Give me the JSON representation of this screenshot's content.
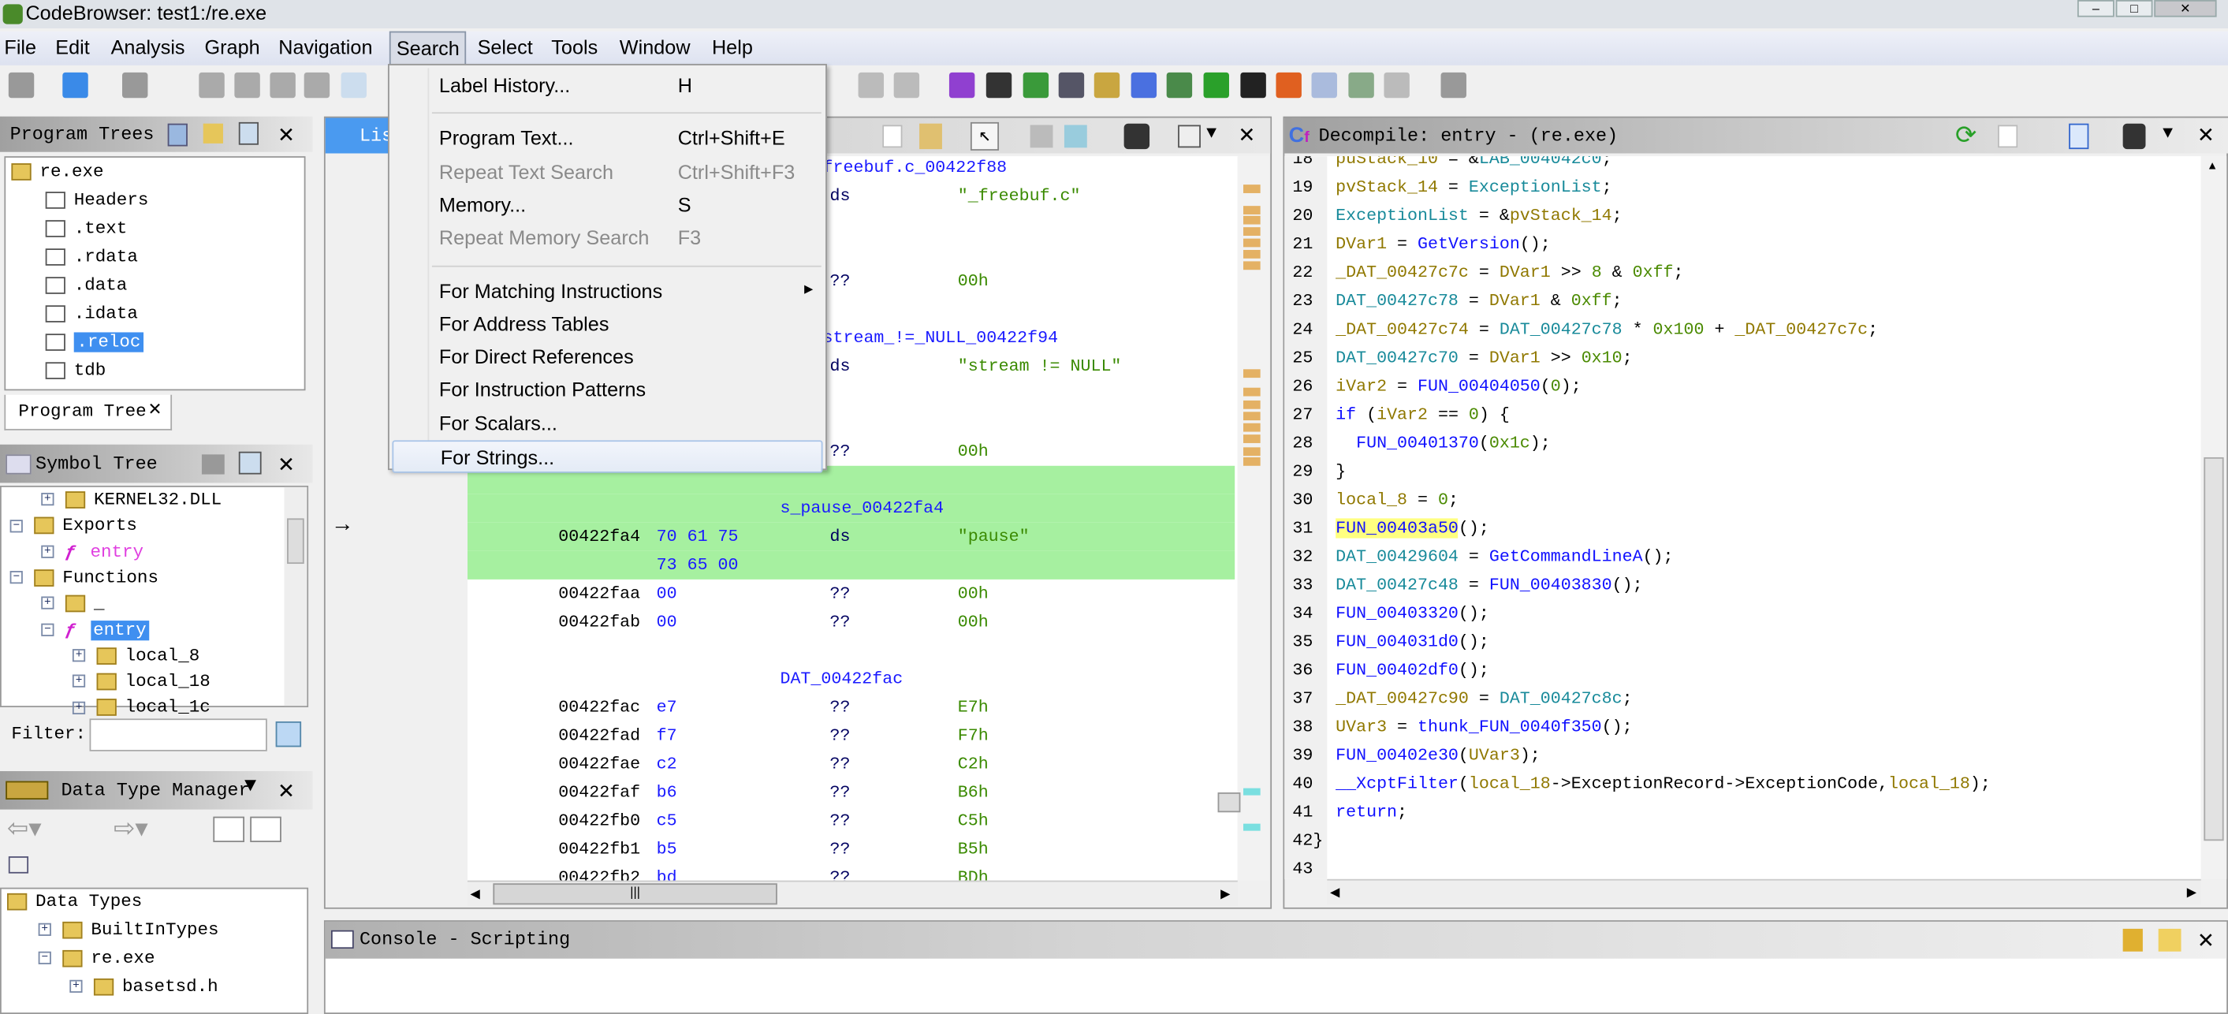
{
  "window": {
    "title": "CodeBrowser: test1:/re.exe",
    "controls": [
      "–",
      "□",
      "✕"
    ]
  },
  "menubar": [
    "File",
    "Edit",
    "Analysis",
    "Graph",
    "Navigation",
    "Search",
    "Select",
    "Tools",
    "Window",
    "Help"
  ],
  "search_menu": [
    {
      "label": "Label History...",
      "shortcut": "H"
    },
    {
      "sep": true
    },
    {
      "label": "Program Text...",
      "shortcut": "Ctrl+Shift+E"
    },
    {
      "label": "Repeat Text Search",
      "shortcut": "Ctrl+Shift+F3",
      "disabled": true
    },
    {
      "label": "Memory...",
      "shortcut": "S"
    },
    {
      "label": "Repeat Memory Search",
      "shortcut": "F3",
      "disabled": true
    },
    {
      "sep": true
    },
    {
      "label": "For Matching Instructions",
      "submenu": true
    },
    {
      "label": "For Address Tables"
    },
    {
      "label": "For Direct References"
    },
    {
      "label": "For Instruction Patterns"
    },
    {
      "label": "For Scalars..."
    },
    {
      "label": "For Strings...",
      "hover": true
    }
  ],
  "program_trees": {
    "title": "Program Trees",
    "tab": "Program Tree",
    "items": [
      {
        "label": "re.exe",
        "level": 0
      },
      {
        "label": "Headers",
        "level": 1
      },
      {
        "label": ".text",
        "level": 1
      },
      {
        "label": ".rdata",
        "level": 1
      },
      {
        "label": ".data",
        "level": 1
      },
      {
        "label": ".idata",
        "level": 1
      },
      {
        "label": ".reloc",
        "level": 1,
        "selected": true
      },
      {
        "label": "tdb",
        "level": 1
      }
    ]
  },
  "symbol_tree": {
    "title": "Symbol Tree",
    "filter_label": "Filter:",
    "filter_value": "",
    "items": [
      {
        "label": "KERNEL32.DLL",
        "level": 1,
        "pm": "+"
      },
      {
        "label": "Exports",
        "level": 0,
        "pm": "-"
      },
      {
        "label": "entry",
        "level": 1,
        "pm": "+",
        "fn": true,
        "color": "#e040e0"
      },
      {
        "label": "Functions",
        "level": 0,
        "pm": "-"
      },
      {
        "label": "_",
        "level": 1,
        "pm": "+"
      },
      {
        "label": "entry",
        "level": 1,
        "pm": "-",
        "fn": true,
        "selected": true
      },
      {
        "label": "local_8",
        "level": 2,
        "pm": "+"
      },
      {
        "label": "local_18",
        "level": 2,
        "pm": "+"
      },
      {
        "label": "local_1c",
        "level": 2,
        "pm": "+"
      }
    ]
  },
  "data_type_manager": {
    "title": "Data Type Manager",
    "items": [
      {
        "label": "Data Types",
        "level": 0
      },
      {
        "label": "BuiltInTypes",
        "level": 1,
        "pm": "+"
      },
      {
        "label": "re.exe",
        "level": 1,
        "pm": "-"
      },
      {
        "label": "basetsd.h",
        "level": 2,
        "pm": "+"
      }
    ]
  },
  "listing": {
    "title": "Listing",
    "rows": [
      {
        "label": "freebuf.c_00422f88",
        "partial": true
      },
      {
        "mn": "ds",
        "op": "\"_freebuf.c\""
      },
      {},
      {},
      {
        "mn": "??",
        "op": "00h"
      },
      {},
      {
        "label": "stream_!=_NULL_00422f94",
        "partial": true
      },
      {
        "mn": "ds",
        "op": "\"stream != NULL\""
      },
      {},
      {},
      {
        "mn": "??",
        "op": "00h"
      },
      {
        "hl": true
      },
      {
        "hl": true,
        "label": "s_pause_00422fa4"
      },
      {
        "hl": true,
        "addr": "00422fa4",
        "bytes": "70 61 75",
        "mn": "ds",
        "op": "\"pause\""
      },
      {
        "hl": true,
        "bytes": "73 65 00"
      },
      {
        "addr": "00422faa",
        "bytes": "00",
        "mn": "??",
        "op": "00h"
      },
      {
        "addr": "00422fab",
        "bytes": "00",
        "mn": "??",
        "op": "00h"
      },
      {},
      {
        "label": "DAT_00422fac"
      },
      {
        "addr": "00422fac",
        "bytes": "e7",
        "mn": "??",
        "op": "E7h"
      },
      {
        "addr": "00422fad",
        "bytes": "f7",
        "mn": "??",
        "op": "F7h"
      },
      {
        "addr": "00422fae",
        "bytes": "c2",
        "mn": "??",
        "op": "C2h"
      },
      {
        "addr": "00422faf",
        "bytes": "b6",
        "mn": "??",
        "op": "B6h"
      },
      {
        "addr": "00422fb0",
        "bytes": "c5",
        "mn": "??",
        "op": "C5h"
      },
      {
        "addr": "00422fb1",
        "bytes": "b5",
        "mn": "??",
        "op": "B5h"
      },
      {
        "addr": "00422fb2",
        "bytes": "bd",
        "mn": "??",
        "op": "BDh"
      }
    ]
  },
  "decompile": {
    "title": "Decompile: entry -  (re.exe)",
    "lines": [
      {
        "n": "18",
        "t": [
          [
            "puStack_10",
            "v"
          ],
          [
            " = &",
            ""
          ],
          [
            "LAB_004042c0",
            "g"
          ],
          [
            ";",
            ""
          ]
        ]
      },
      {
        "n": "19",
        "t": [
          [
            "pvStack_14",
            "v"
          ],
          [
            " = ",
            ""
          ],
          [
            "ExceptionList",
            "g"
          ],
          [
            ";",
            ""
          ]
        ]
      },
      {
        "n": "20",
        "t": [
          [
            "ExceptionList",
            "g"
          ],
          [
            " = &",
            ""
          ],
          [
            "pvStack_14",
            "v"
          ],
          [
            ";",
            ""
          ]
        ]
      },
      {
        "n": "21",
        "t": [
          [
            "DVar1",
            "v"
          ],
          [
            " = ",
            ""
          ],
          [
            "GetVersion",
            "f"
          ],
          [
            "();",
            ""
          ]
        ]
      },
      {
        "n": "22",
        "t": [
          [
            "_DAT_00427c7c",
            "v"
          ],
          [
            " = ",
            ""
          ],
          [
            "DVar1",
            "v"
          ],
          [
            " >> ",
            ""
          ],
          [
            "8",
            "c"
          ],
          [
            " & ",
            ""
          ],
          [
            "0xff",
            "c"
          ],
          [
            ";",
            ""
          ]
        ]
      },
      {
        "n": "23",
        "t": [
          [
            "DAT_00427c78",
            "g"
          ],
          [
            " = ",
            ""
          ],
          [
            "DVar1",
            "v"
          ],
          [
            " & ",
            ""
          ],
          [
            "0xff",
            "c"
          ],
          [
            ";",
            ""
          ]
        ]
      },
      {
        "n": "24",
        "t": [
          [
            "_DAT_00427c74",
            "v"
          ],
          [
            " = ",
            ""
          ],
          [
            "DAT_00427c78",
            "g"
          ],
          [
            " * ",
            ""
          ],
          [
            "0x100",
            "c"
          ],
          [
            " + ",
            ""
          ],
          [
            "_DAT_00427c7c",
            "v"
          ],
          [
            ";",
            ""
          ]
        ]
      },
      {
        "n": "25",
        "t": [
          [
            "DAT_00427c70",
            "g"
          ],
          [
            " = ",
            ""
          ],
          [
            "DVar1",
            "v"
          ],
          [
            " >> ",
            ""
          ],
          [
            "0x10",
            "c"
          ],
          [
            ";",
            ""
          ]
        ]
      },
      {
        "n": "26",
        "t": [
          [
            "iVar2",
            "v"
          ],
          [
            " = ",
            ""
          ],
          [
            "FUN_00404050",
            "f"
          ],
          [
            "(",
            ""
          ],
          [
            "0",
            "c"
          ],
          [
            ");",
            ""
          ]
        ]
      },
      {
        "n": "27",
        "t": [
          [
            "if",
            "k"
          ],
          [
            " (",
            ""
          ],
          [
            "iVar2",
            "v"
          ],
          [
            " == ",
            ""
          ],
          [
            "0",
            "c"
          ],
          [
            ") {",
            ""
          ]
        ]
      },
      {
        "n": "28",
        "t": [
          [
            "  ",
            ""
          ],
          [
            "FUN_00401370",
            "f"
          ],
          [
            "(",
            ""
          ],
          [
            "0x1c",
            "c"
          ],
          [
            ");",
            ""
          ]
        ]
      },
      {
        "n": "29",
        "t": [
          [
            "}",
            ""
          ]
        ]
      },
      {
        "n": "30",
        "t": [
          [
            "local_8",
            "v"
          ],
          [
            " = ",
            ""
          ],
          [
            "0",
            "c"
          ],
          [
            ";",
            ""
          ]
        ]
      },
      {
        "n": "31",
        "t": [
          [
            "FUN_00403a50",
            "fh"
          ],
          [
            "();",
            ""
          ]
        ]
      },
      {
        "n": "32",
        "t": [
          [
            "DAT_00429604",
            "g"
          ],
          [
            " = ",
            ""
          ],
          [
            "GetCommandLineA",
            "f"
          ],
          [
            "();",
            ""
          ]
        ]
      },
      {
        "n": "33",
        "t": [
          [
            "DAT_00427c48",
            "g"
          ],
          [
            " = ",
            ""
          ],
          [
            "FUN_00403830",
            "f"
          ],
          [
            "();",
            ""
          ]
        ]
      },
      {
        "n": "34",
        "t": [
          [
            "FUN_00403320",
            "f"
          ],
          [
            "();",
            ""
          ]
        ]
      },
      {
        "n": "35",
        "t": [
          [
            "FUN_004031d0",
            "f"
          ],
          [
            "();",
            ""
          ]
        ]
      },
      {
        "n": "36",
        "t": [
          [
            "FUN_00402df0",
            "f"
          ],
          [
            "();",
            ""
          ]
        ]
      },
      {
        "n": "37",
        "t": [
          [
            "_DAT_00427c90",
            "v"
          ],
          [
            " = ",
            ""
          ],
          [
            "DAT_00427c8c",
            "g"
          ],
          [
            ";",
            ""
          ]
        ]
      },
      {
        "n": "38",
        "t": [
          [
            "UVar3",
            "v"
          ],
          [
            " = ",
            ""
          ],
          [
            "thunk_FUN_0040f350",
            "f"
          ],
          [
            "();",
            ""
          ]
        ]
      },
      {
        "n": "39",
        "t": [
          [
            "FUN_00402e30",
            "f"
          ],
          [
            "(",
            ""
          ],
          [
            "UVar3",
            "v"
          ],
          [
            ");",
            ""
          ]
        ]
      },
      {
        "n": "40",
        "t": [
          [
            "__XcptFilter",
            "f"
          ],
          [
            "(",
            ""
          ],
          [
            "local_18",
            "v"
          ],
          [
            "->ExceptionRecord->ExceptionCode,",
            ""
          ],
          [
            "local_18",
            "v"
          ],
          [
            ");",
            ""
          ]
        ]
      },
      {
        "n": "41",
        "t": [
          [
            "return",
            "k"
          ],
          [
            ";",
            ""
          ]
        ]
      },
      {
        "n": "42",
        "t": [
          [
            "}",
            ""
          ]
        ],
        "outer": true
      },
      {
        "n": "43",
        "t": []
      }
    ]
  },
  "console": {
    "title": "Console - Scripting"
  },
  "colors": {
    "highlight_green": "#a6f0a0",
    "selection": "#3f8ff0",
    "tab_active": "#4a9af0",
    "token_highlight": "#ffff80"
  }
}
